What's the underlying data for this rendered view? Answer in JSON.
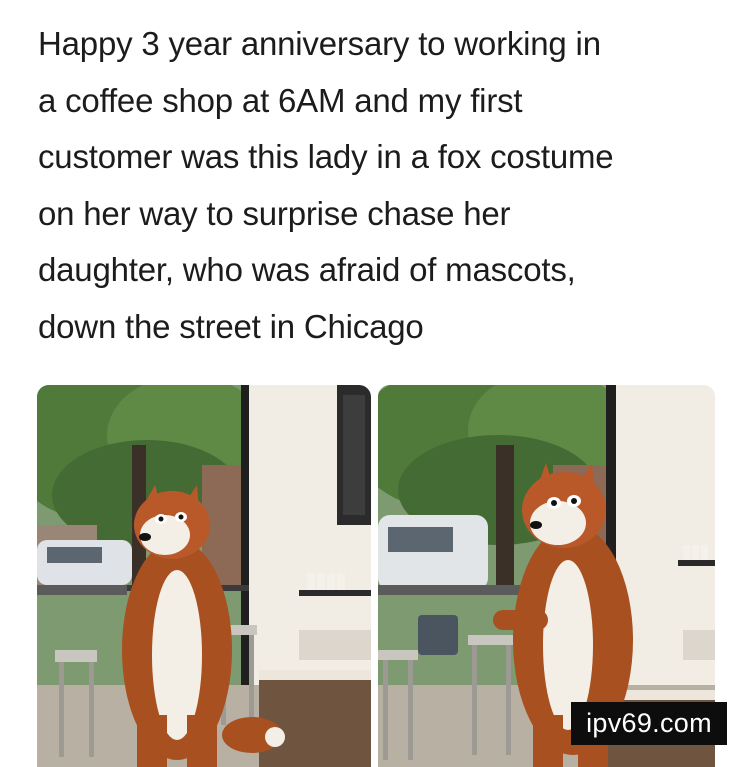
{
  "post": {
    "caption_lines": [
      "Happy 3 year anniversary to working in",
      "a coffee shop at 6AM and my first",
      "customer was this lady in a fox costume",
      "on her way to surprise chase her",
      "daughter, who was afraid of mascots,",
      "down the street in Chicago"
    ]
  },
  "photos": [
    {
      "subject": "fox-mascot-costume",
      "scene": "coffee-shop-window"
    },
    {
      "subject": "fox-mascot-costume",
      "scene": "coffee-shop-window"
    }
  ],
  "watermark": {
    "text": "ipv69.com"
  },
  "colors": {
    "text": "#1c1c1c",
    "fox_orange": "#a8501f",
    "fox_white": "#f4efe6",
    "foliage": "#4f7a3a",
    "watermark_bg": "#0d0d0d"
  }
}
